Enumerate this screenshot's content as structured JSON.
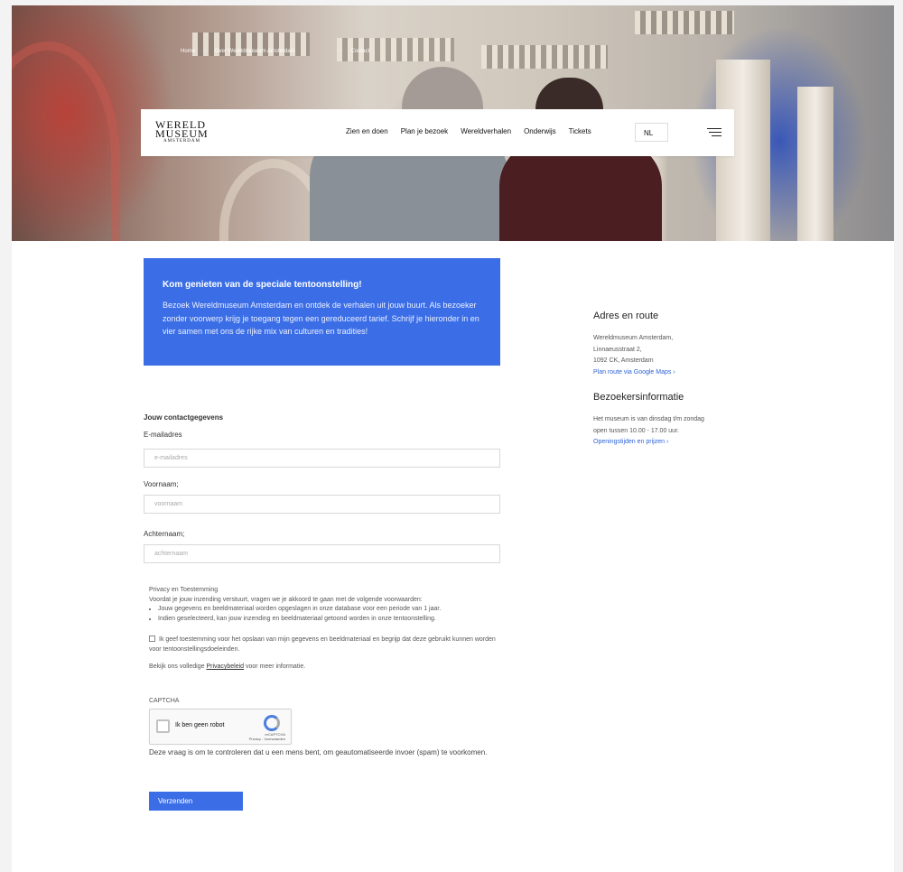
{
  "breadcrumb": [
    "Home",
    "Over Wereldmuseum Amsterdam",
    "Contact"
  ],
  "logo": {
    "line1": "WERELD",
    "line2": "MUSEUM",
    "line3": "AMSTERDAM"
  },
  "nav": {
    "items": [
      "Zien en doen",
      "Plan je bezoek",
      "Wereldverhalen",
      "Onderwijs",
      "Tickets"
    ],
    "language": "NL",
    "menu_icon": "hamburger-menu-icon"
  },
  "promo": {
    "title": "Kom genieten van de speciale tentoonstelling!",
    "text": "Bezoek Wereldmuseum Amsterdam en ontdek de verhalen uit jouw buurt. Als bezoeker zonder voorwerp krijg je toegang tegen een gereduceerd tarief. Schrijf je hieronder in en vier samen met ons de rijke mix van culturen en tradities!"
  },
  "sidebar": {
    "address_title": "Adres en route",
    "address_lines": [
      "Wereldmuseum Amsterdam,",
      "Linnaeusstraat 2,",
      "1092 CK, Amsterdam"
    ],
    "route_link": "Plan route via Google Maps  ›",
    "visitor_title": "Bezoekersinformatie",
    "visitor_text": "Het museum is van dinsdag t/m zondag  open tussen 10.00 - 17.00 uur.",
    "hours_link": "Openingstijden en prijzen  ›"
  },
  "form": {
    "section_title": "Jouw contactgegevens",
    "email_label": "E-mailadres",
    "email_placeholder": "e-mailadres",
    "firstname_label": "Voornaam;",
    "firstname_placeholder": "voornaam",
    "lastname_label": "Achternaam;",
    "lastname_placeholder": "achternaam"
  },
  "privacy": {
    "title": "Privacy en Toestemming",
    "intro": "Voordat je jouw inzending verstuurt, vragen we je akkoord te gaan met de volgende voorwaarden:",
    "bullets": [
      "Jouw gegevens en beeldmateriaal worden opgeslagen in onze database voor een periode van 1 jaar.",
      "Indien geselecteerd, kan jouw inzending en beeldmateriaal getoond worden in onze tentoonstelling."
    ],
    "consent": "Ik geef toestemming voor het opslaan van mijn gegevens en beeldmateriaal en begrijp dat deze gebruikt kunnen worden voor tentoonstellingsdoeleinden.",
    "policy_prefix": "Bekijk ons volledige ",
    "policy_link": "Privacybeleid",
    "policy_suffix": " voor meer informatie."
  },
  "captcha": {
    "label": "CAPTCHA",
    "checkbox_text": "Ik ben geen robot",
    "brand": "reCAPTCHA",
    "terms": "Privacy - Voorwaarden",
    "note": "Deze vraag is om te controleren dat u een mens bent, om geautomatiseerde invoer (spam) te voorkomen."
  },
  "submit_label": "Verzenden"
}
